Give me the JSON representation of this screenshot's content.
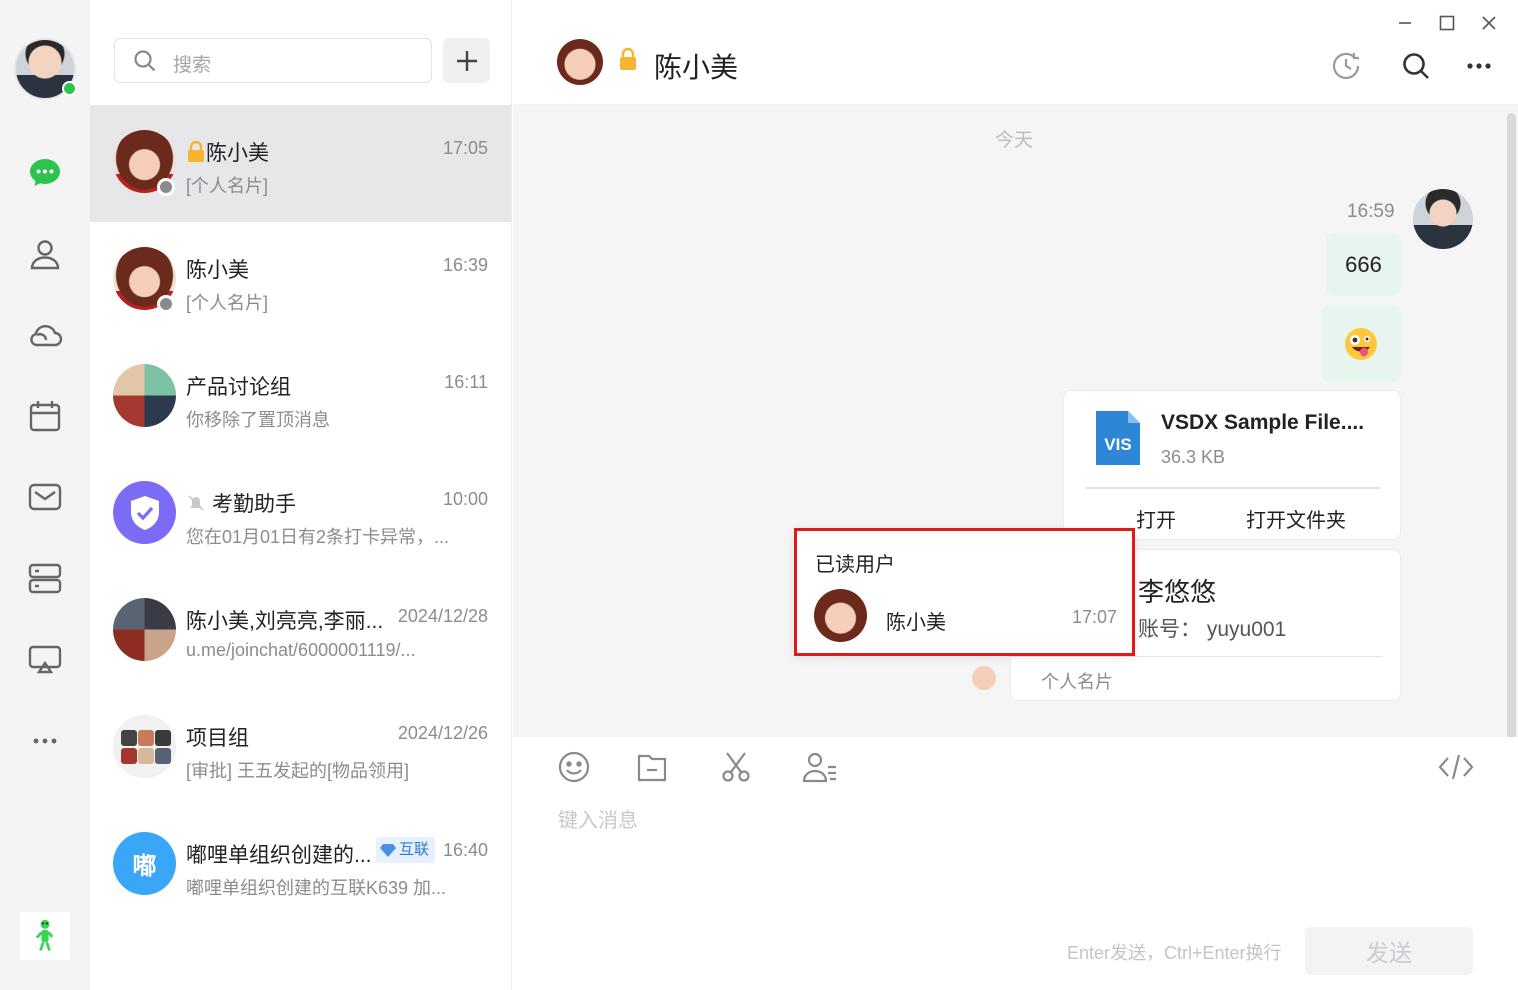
{
  "rail": {
    "icons": [
      "chat-icon",
      "contacts-icon",
      "cloud-icon",
      "calendar-icon",
      "mail-icon",
      "storage-icon",
      "screen-share-icon",
      "more-icon"
    ]
  },
  "search": {
    "placeholder": "搜索"
  },
  "chats": [
    {
      "name": "陈小美",
      "time": "17:05",
      "preview": "[个人名片]",
      "locked": true,
      "active": true
    },
    {
      "name": "陈小美",
      "time": "16:39",
      "preview": "[个人名片]"
    },
    {
      "name": "产品讨论组",
      "time": "16:11",
      "preview": "你移除了置顶消息"
    },
    {
      "name": "考勤助手",
      "time": "10:00",
      "preview": "您在01月01日有2条打卡异常，..."
    },
    {
      "name": "陈小美,刘亮亮,李丽...",
      "time": "2024/12/28",
      "preview": "u.me/joinchat/6000001119/..."
    },
    {
      "name": "项目组",
      "time": "2024/12/26",
      "preview": "[审批] 王五发起的[物品领用]"
    },
    {
      "name": "嘟哩单组织创建的...",
      "time": "16:40",
      "preview": "嘟哩单组织创建的互联K639 加...",
      "badge": "互联",
      "avatar_text": "嘟"
    }
  ],
  "header": {
    "title": "陈小美"
  },
  "messages": {
    "day_label": "今天",
    "time": "16:59",
    "text": "666",
    "file": {
      "name": "VSDX Sample File....",
      "size": "36.3 KB",
      "icon_text": "VIS",
      "open": "打开",
      "open_folder": "打开文件夹"
    },
    "contact_card": {
      "name": "李悠悠",
      "account": "账号：  yuyu001",
      "type": "个人名片"
    }
  },
  "read_popup": {
    "title": "已读用户",
    "user": "陈小美",
    "time": "17:07"
  },
  "composer": {
    "placeholder": "键入消息",
    "hint": "Enter发送，Ctrl+Enter换行",
    "send": "发送"
  },
  "colors": {
    "accent_green": "#2dc44d",
    "highlight_red": "#e01919",
    "bubble": "#e8f4ee"
  }
}
